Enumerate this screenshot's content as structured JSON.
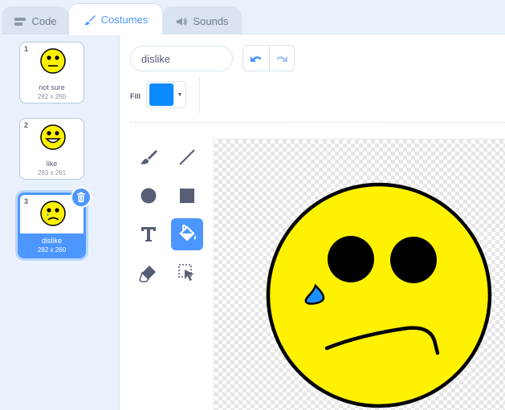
{
  "tabs": [
    {
      "label": "Code",
      "icon": "code-icon"
    },
    {
      "label": "Costumes",
      "icon": "paintbrush-icon"
    },
    {
      "label": "Sounds",
      "icon": "speaker-icon"
    }
  ],
  "costumes": [
    {
      "number": "1",
      "name": "not sure",
      "size": "282 x 260",
      "face": "neutral"
    },
    {
      "number": "2",
      "name": "like",
      "size": "283 x 261",
      "face": "smile"
    },
    {
      "number": "3",
      "name": "dislike",
      "size": "282 x 260",
      "face": "sad",
      "selected": true
    }
  ],
  "editor": {
    "costume_name": "dislike",
    "fill_label": "Fill",
    "fill_color": "#0b8bff",
    "active_tool": "fill-tool"
  },
  "colors": {
    "accent": "#4c97ff",
    "face_yellow": "#fff200",
    "tear_blue": "#1e8fff"
  }
}
